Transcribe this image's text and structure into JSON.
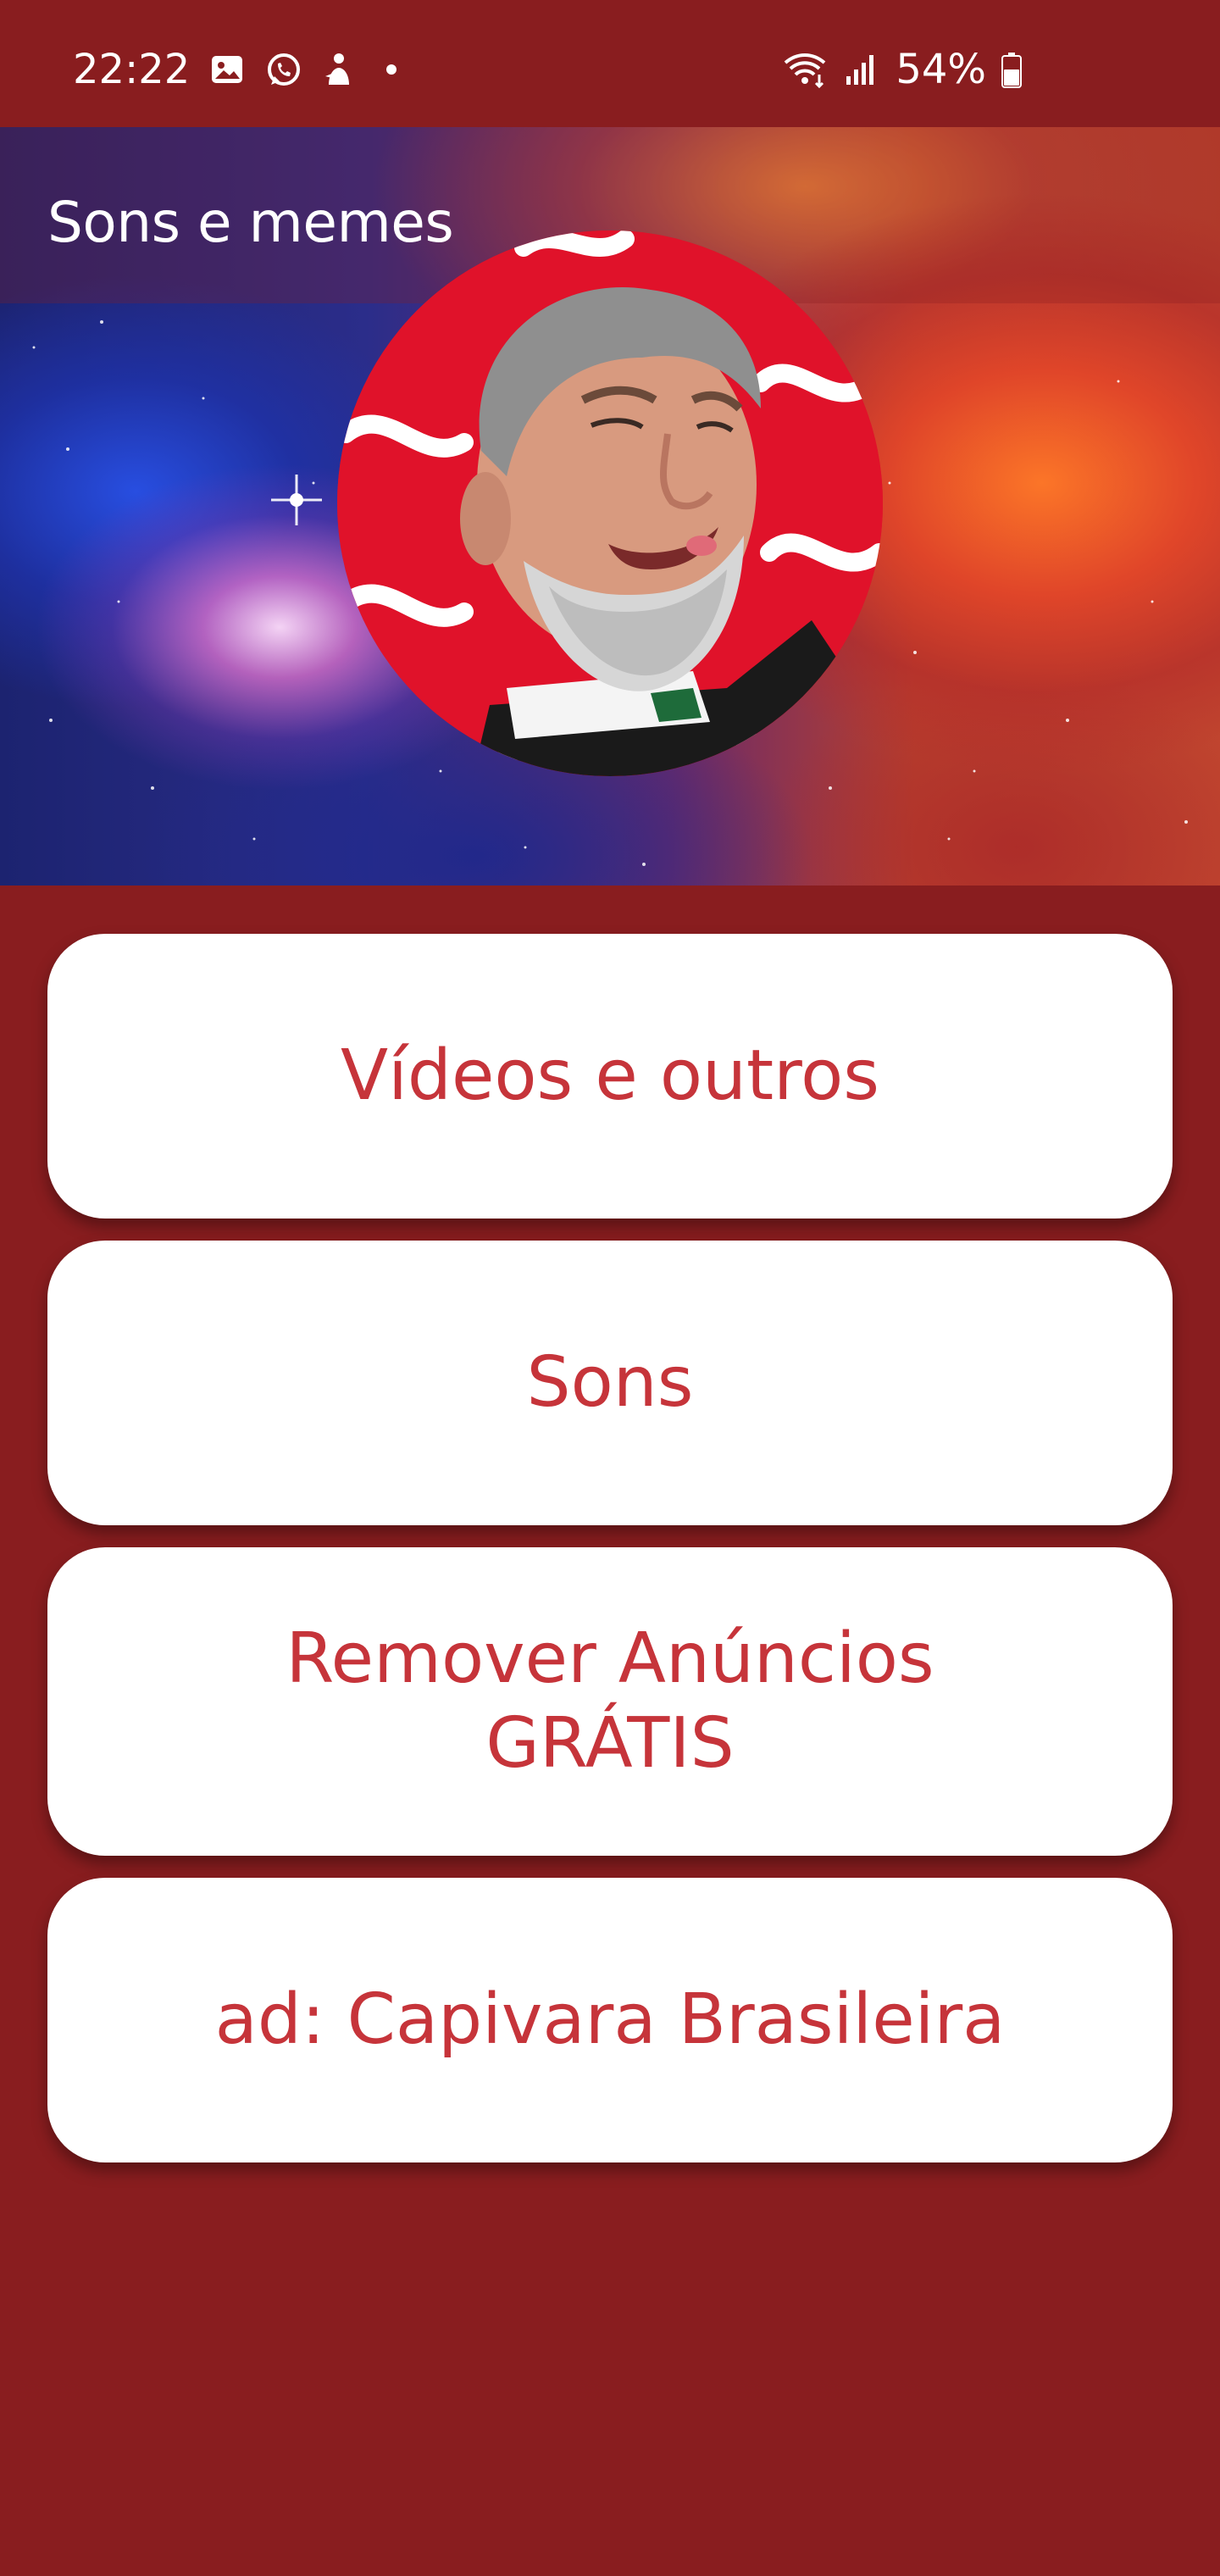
{
  "status_bar": {
    "time": "22:22",
    "battery": "54%",
    "icons": [
      "gallery-icon",
      "whatsapp-icon",
      "notification-app-icon",
      "dot-icon",
      "wifi-icon",
      "signal-icon",
      "battery-icon"
    ]
  },
  "app_bar": {
    "title": "Sons e memes"
  },
  "menu": {
    "videos_label": "Vídeos e outros",
    "sounds_label": "Sons",
    "remove_ads_line1": "Remover Anúncios",
    "remove_ads_line2": "GRÁTIS",
    "ad_label": "ad: Capivara Brasileira"
  },
  "colors": {
    "background": "#891d1f",
    "button_bg": "#ffffff",
    "button_text": "#c6343a",
    "avatar_bg": "#e0122a"
  }
}
